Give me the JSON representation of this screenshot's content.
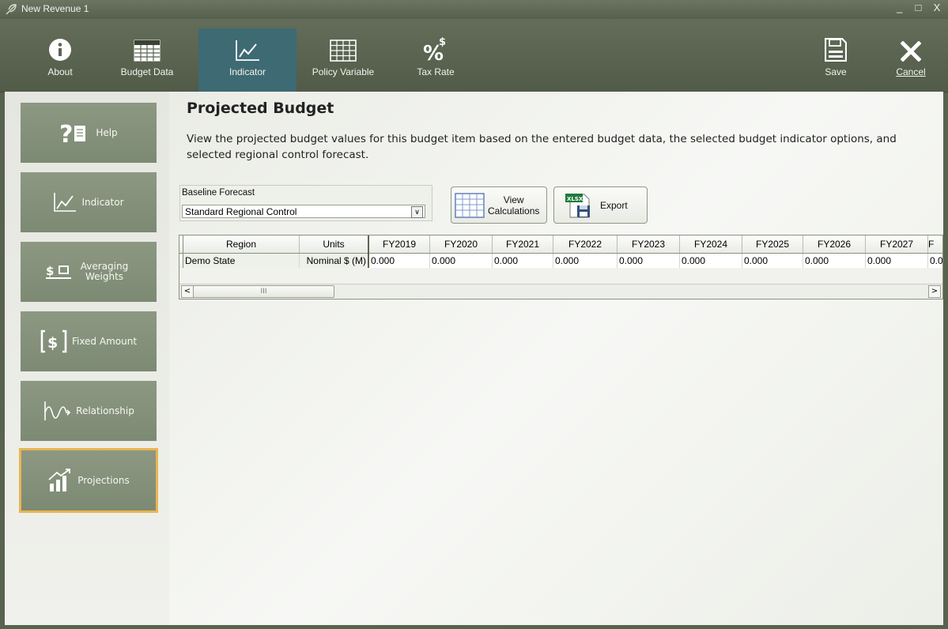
{
  "window": {
    "title": "New Revenue 1",
    "controls": [
      "_",
      "□",
      "X"
    ]
  },
  "ribbon": {
    "buttons": [
      {
        "label": "About",
        "icon": "info-icon"
      },
      {
        "label": "Budget Data",
        "icon": "table-icon"
      },
      {
        "label": "Indicator",
        "icon": "line-chart-icon",
        "active": true
      },
      {
        "label": "Policy Variable",
        "icon": "grid-icon"
      },
      {
        "label": "Tax Rate",
        "icon": "percent-dollar-icon"
      },
      {
        "label": "Save",
        "icon": "save-icon"
      },
      {
        "label": "Cancel",
        "icon": "close-icon"
      }
    ]
  },
  "sidebar": {
    "items": [
      {
        "label": "Help",
        "icon": "help-icon"
      },
      {
        "label": "Indicator",
        "icon": "line-chart-icon"
      },
      {
        "label": "Averaging Weights",
        "icon": "averaging-weights-icon"
      },
      {
        "label": "Fixed Amount",
        "icon": "fixed-amount-icon"
      },
      {
        "label": "Relationship",
        "icon": "relationship-icon"
      },
      {
        "label": "Projections",
        "icon": "projections-icon",
        "selected": true
      }
    ]
  },
  "main": {
    "title": "Projected Budget",
    "description": "View the projected budget values for this budget item based on the entered budget data, the selected budget indicator options, and selected regional control forecast.",
    "forecast": {
      "label": "Baseline Forecast",
      "value": "Standard Regional Control"
    },
    "view_button": {
      "line1": "View",
      "line2": "Calculations"
    },
    "export_button": {
      "label": "Export",
      "badge": "XLSX"
    },
    "grid": {
      "columns": [
        "Region",
        "Units",
        "FY2019",
        "FY2020",
        "FY2021",
        "FY2022",
        "FY2023",
        "FY2024",
        "FY2025",
        "FY2026",
        "FY2027",
        "F"
      ],
      "rows": [
        [
          "Demo State",
          "Nominal $ (M)",
          "0.000",
          "0.000",
          "0.000",
          "0.000",
          "0.000",
          "0.000",
          "0.000",
          "0.000",
          "0.000",
          "0.0"
        ]
      ],
      "scroll_left": "<",
      "scroll_right": ">",
      "thumb_grip": "III"
    }
  },
  "colors": {
    "accent_selected": "#e8b552",
    "active_tab": "#3e6a74",
    "ribbon": "#5b6551",
    "sidebar_button": "#84917a"
  }
}
